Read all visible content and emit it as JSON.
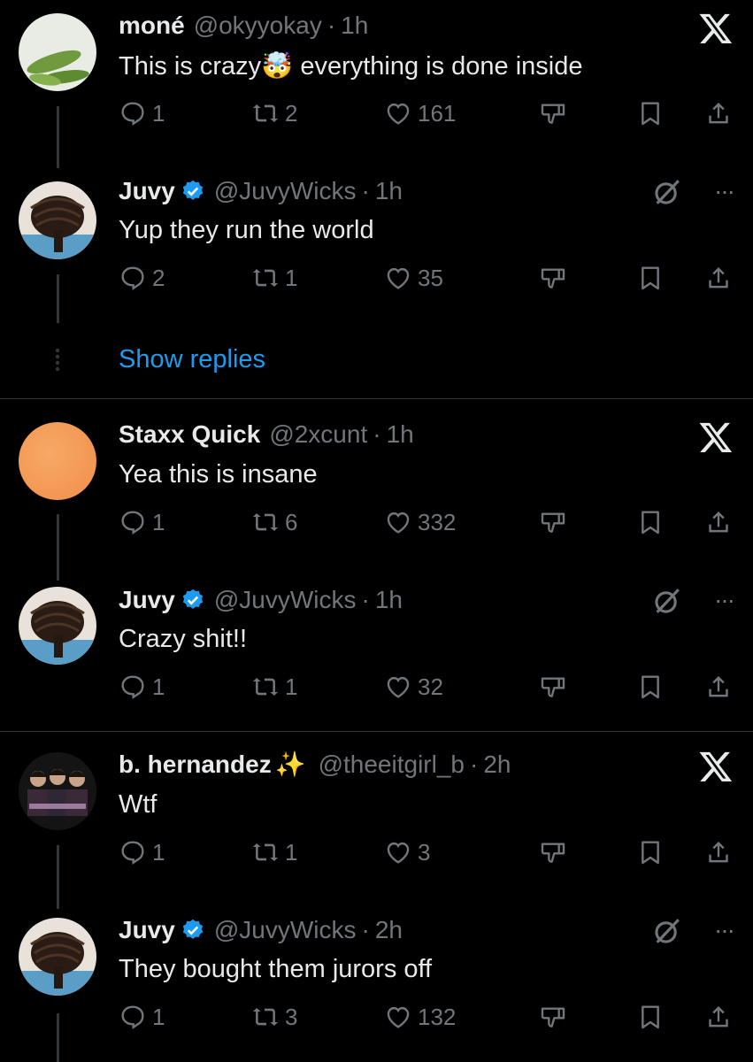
{
  "thread1": {
    "op": {
      "name": "moné",
      "handle": "@okyyokay",
      "time": "1h",
      "text_before": "This is crazy",
      "emoji": "🤯",
      "text_after": "everything is done inside",
      "replies": "1",
      "reposts": "2",
      "likes": "161"
    },
    "reply": {
      "name": "Juvy",
      "handle": "@JuvyWicks",
      "time": "1h",
      "text": "Yup they run the world",
      "replies": "2",
      "reposts": "1",
      "likes": "35"
    },
    "show_replies": "Show replies"
  },
  "thread2": {
    "op": {
      "name": "Staxx Quick",
      "handle": "@2xcunt",
      "time": "1h",
      "text": "Yea this is insane",
      "replies": "1",
      "reposts": "6",
      "likes": "332"
    },
    "reply": {
      "name": "Juvy",
      "handle": "@JuvyWicks",
      "time": "1h",
      "text": "Crazy shit!!",
      "replies": "1",
      "reposts": "1",
      "likes": "32"
    }
  },
  "thread3": {
    "op": {
      "name": "b. hernandez",
      "name_emoji": "✨",
      "handle": "@theeitgirl_b",
      "time": "2h",
      "text": "Wtf",
      "replies": "1",
      "reposts": "1",
      "likes": "3"
    },
    "reply": {
      "name": "Juvy",
      "handle": "@JuvyWicks",
      "time": "2h",
      "text": "They bought them jurors off",
      "replies": "1",
      "reposts": "3",
      "likes": "132"
    }
  },
  "separator_dot": "·",
  "more_label": "···",
  "colors": {
    "background": "#000000",
    "text": "#e7e9ea",
    "muted": "#71767b",
    "link": "#1d9bf0",
    "verified": "#1d9bf0"
  },
  "icons": [
    "reply-icon",
    "repost-icon",
    "like-icon",
    "dislike-icon",
    "bookmark-icon",
    "share-icon",
    "x-logo-icon",
    "grok-icon",
    "verified-badge-icon"
  ]
}
